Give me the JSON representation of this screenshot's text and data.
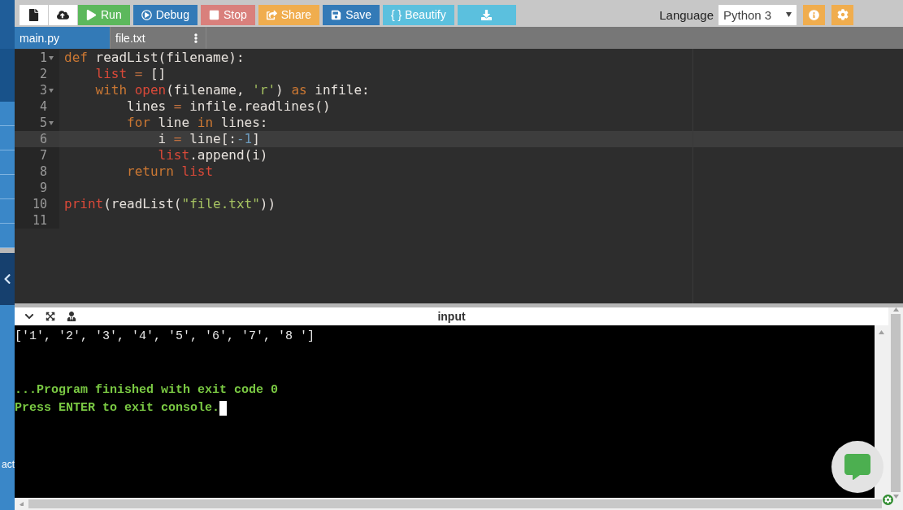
{
  "sidebar": {
    "items": [
      {
        "kind": "dark"
      },
      {
        "kind": "darker"
      },
      {
        "kind": "item"
      },
      {
        "kind": "item"
      },
      {
        "kind": "item"
      },
      {
        "kind": "item"
      },
      {
        "kind": "item"
      },
      {
        "kind": "item"
      },
      {
        "kind": "toggle"
      },
      {
        "kind": "spacer"
      }
    ],
    "footer_text": "act"
  },
  "toolbar": {
    "buttons": [
      {
        "kind": "icon"
      },
      {
        "kind": "icon"
      },
      {
        "kind": "labeled",
        "label": "Run"
      },
      {
        "kind": "labeled",
        "label": "Debug"
      },
      {
        "kind": "labeled",
        "label": "Stop"
      },
      {
        "kind": "labeled",
        "label": "Share"
      },
      {
        "kind": "labeled",
        "label": "Save"
      },
      {
        "kind": "labeled",
        "label": "{ } Beautify"
      },
      {
        "kind": "icon"
      }
    ],
    "language_label": "Language",
    "language": "Python 3"
  },
  "tabs": [
    {
      "label": "main.py",
      "selected": true
    },
    {
      "label": "file.txt",
      "selected": false
    }
  ],
  "editor": {
    "lines": [
      {
        "number": "1",
        "foldable": true,
        "active": false,
        "tokens": [
          {
            "kind": "kw",
            "text": "def"
          },
          {
            "kind": "text",
            "text": " readList(filename):"
          }
        ]
      },
      {
        "number": "2",
        "foldable": false,
        "active": false,
        "tokens": [
          {
            "kind": "builtin",
            "text": "    list"
          },
          {
            "kind": "op",
            "text": " ="
          },
          {
            "kind": "text",
            "text": " []"
          }
        ]
      },
      {
        "number": "3",
        "foldable": true,
        "active": false,
        "tokens": [
          {
            "kind": "kw",
            "text": "    with"
          },
          {
            "kind": "builtin",
            "text": " open"
          },
          {
            "kind": "text",
            "text": "(filename, "
          },
          {
            "kind": "str",
            "text": "'r'"
          },
          {
            "kind": "text",
            "text": ")"
          },
          {
            "kind": "kw",
            "text": " as"
          },
          {
            "kind": "text",
            "text": " infile:"
          }
        ]
      },
      {
        "number": "4",
        "foldable": false,
        "active": false,
        "tokens": [
          {
            "kind": "text",
            "text": "        lines"
          },
          {
            "kind": "op",
            "text": " ="
          },
          {
            "kind": "text",
            "text": " infile.readlines()"
          }
        ]
      },
      {
        "number": "5",
        "foldable": true,
        "active": false,
        "tokens": [
          {
            "kind": "kw",
            "text": "        for"
          },
          {
            "kind": "text",
            "text": " line"
          },
          {
            "kind": "kw",
            "text": " in"
          },
          {
            "kind": "text",
            "text": " lines:"
          }
        ]
      },
      {
        "number": "6",
        "foldable": false,
        "active": true,
        "tokens": [
          {
            "kind": "text",
            "text": "            i"
          },
          {
            "kind": "op",
            "text": " ="
          },
          {
            "kind": "text",
            "text": " line[:"
          },
          {
            "kind": "num",
            "text": "-1"
          },
          {
            "kind": "text",
            "text": "]"
          }
        ]
      },
      {
        "number": "7",
        "foldable": false,
        "active": false,
        "tokens": [
          {
            "kind": "builtin",
            "text": "            list"
          },
          {
            "kind": "text",
            "text": ".append(i)"
          }
        ]
      },
      {
        "number": "8",
        "foldable": false,
        "active": false,
        "tokens": [
          {
            "kind": "kw",
            "text": "        return"
          },
          {
            "kind": "builtin",
            "text": " list"
          }
        ]
      },
      {
        "number": "9",
        "foldable": false,
        "active": false
      },
      {
        "number": "10",
        "foldable": false,
        "active": false,
        "tokens": [
          {
            "kind": "builtin",
            "text": "print"
          },
          {
            "kind": "text",
            "text": "(readList("
          },
          {
            "kind": "str",
            "text": "\"file.txt\""
          },
          {
            "kind": "text",
            "text": "))"
          }
        ]
      },
      {
        "number": "11",
        "foldable": false,
        "active": false
      }
    ]
  },
  "console": {
    "title": "input",
    "output": [
      "['1', '2', '3', '4', '5', '6', '7', '8 ']"
    ],
    "status": [
      "...Program finished with exit code 0",
      "Press ENTER to exit console."
    ]
  }
}
